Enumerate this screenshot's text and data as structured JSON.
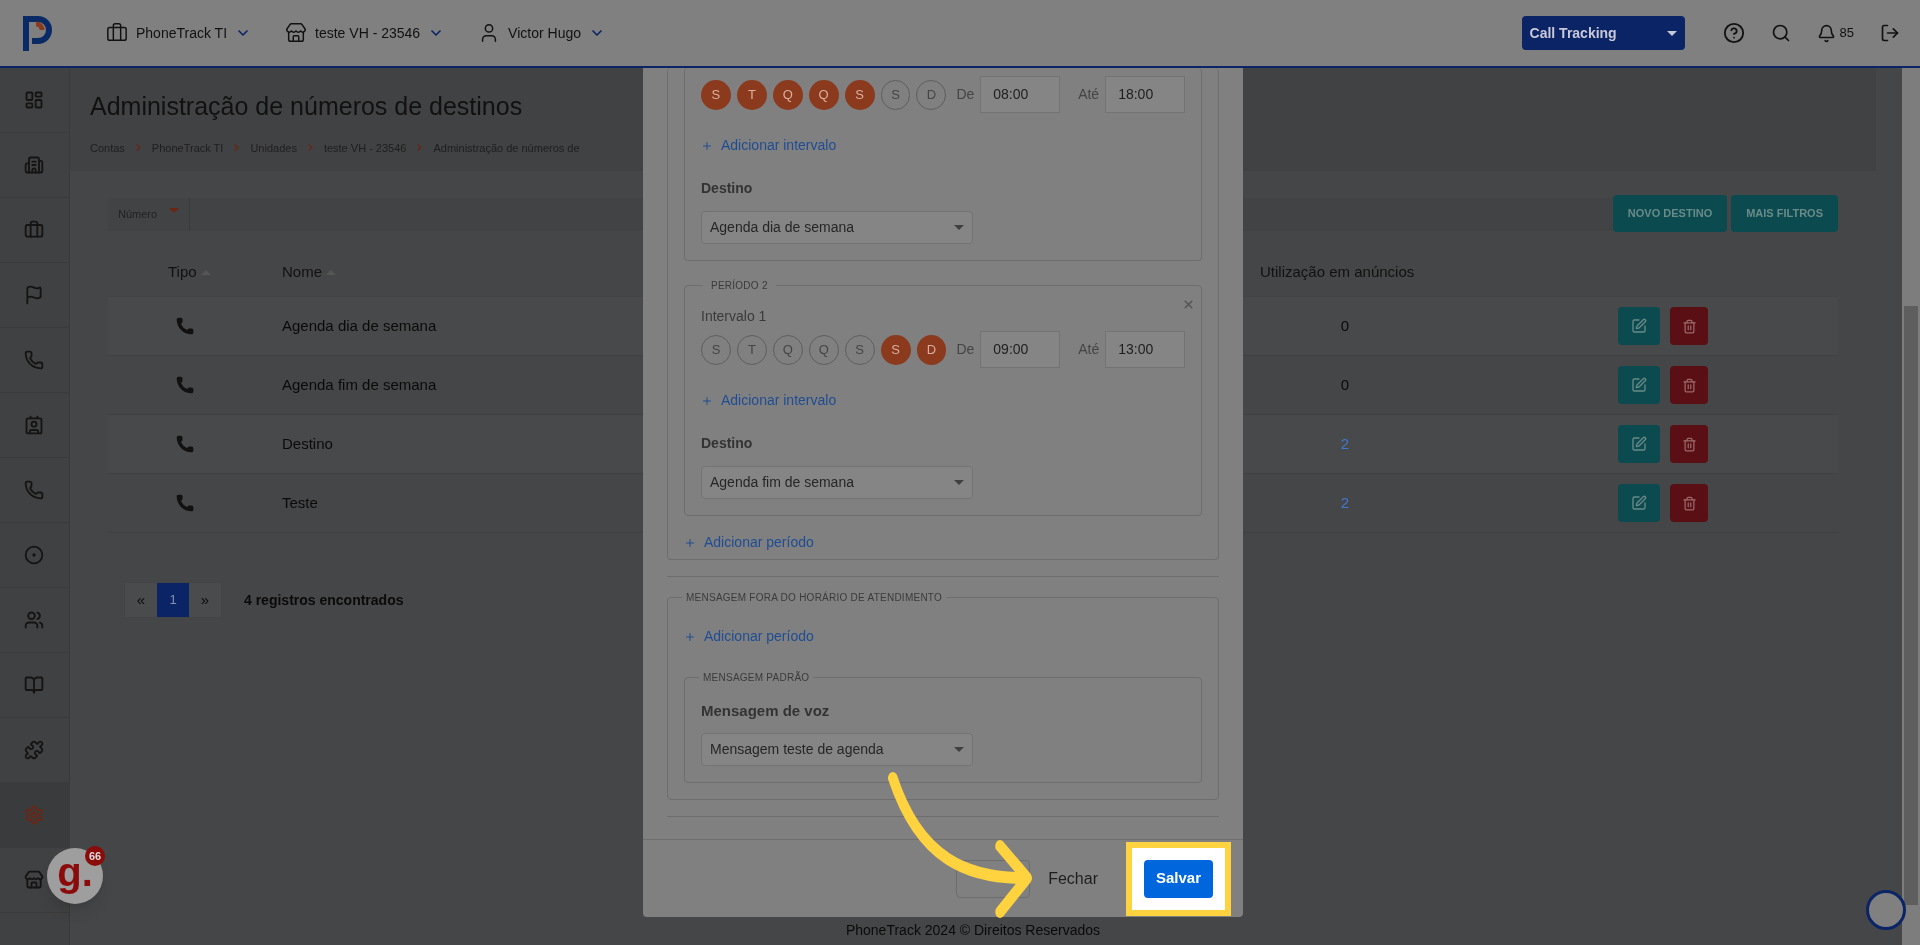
{
  "header": {
    "nav": [
      {
        "label": "PhoneTrack TI"
      },
      {
        "label": "teste VH - 23546"
      },
      {
        "label": "Victor Hugo"
      }
    ],
    "product_select": "Call Tracking",
    "notifications": "85"
  },
  "sidebar": {
    "items": [
      {
        "selected": false
      },
      {
        "selected": false
      },
      {
        "selected": false
      },
      {
        "selected": false
      },
      {
        "selected": false
      },
      {
        "selected": false
      },
      {
        "selected": false
      },
      {
        "selected": false
      },
      {
        "selected": false
      },
      {
        "selected": false
      },
      {
        "selected": false
      },
      {
        "selected": true
      },
      {
        "selected": false
      }
    ]
  },
  "page": {
    "title": "Administração de números de destinos",
    "breadcrumb": [
      "Contas",
      "PhoneTrack TI",
      "Unidades",
      "teste VH - 23546",
      "Administração de números de"
    ],
    "filter": {
      "label": "Número"
    },
    "actions": [
      "NOVO DESTINO",
      "MAIS FILTROS"
    ],
    "table": {
      "columns": [
        {
          "label": "Tipo",
          "sortable": true
        },
        {
          "label": "Nome",
          "sortable": true
        },
        {
          "label": "Utilização em anúncios",
          "sortable": false
        }
      ],
      "rows": [
        {
          "name": "Agenda dia de semana",
          "usage": "0",
          "linked": false
        },
        {
          "name": "Agenda fim de semana",
          "usage": "0",
          "linked": false
        },
        {
          "name": "Destino",
          "usage": "2",
          "linked": true
        },
        {
          "name": "Teste",
          "usage": "2",
          "linked": true
        }
      ]
    },
    "pagination": {
      "prev": "«",
      "pages": [
        {
          "label": "1",
          "selected": true
        }
      ],
      "next": "»",
      "summary": "4 registros encontrados"
    }
  },
  "modal": {
    "periods": [
      {
        "removable": false,
        "intervals": [
          {
            "days": [
              {
                "letter": "S",
                "selected": true
              },
              {
                "letter": "T",
                "selected": true
              },
              {
                "letter": "Q",
                "selected": true
              },
              {
                "letter": "Q",
                "selected": true
              },
              {
                "letter": "S",
                "selected": true
              },
              {
                "letter": "S",
                "selected": false
              },
              {
                "letter": "D",
                "selected": false
              }
            ],
            "from_label": "De",
            "from": "08:00",
            "to_label": "Até",
            "to": "18:00"
          }
        ],
        "add_interval": "Adicionar intervalo",
        "destination_label": "Destino",
        "destination": "Agenda dia de semana"
      },
      {
        "legend": "PERÍODO 2",
        "removable": true,
        "intervals": [
          {
            "label": "Intervalo 1",
            "days": [
              {
                "letter": "S",
                "selected": false
              },
              {
                "letter": "T",
                "selected": false
              },
              {
                "letter": "Q",
                "selected": false
              },
              {
                "letter": "Q",
                "selected": false
              },
              {
                "letter": "S",
                "selected": false
              },
              {
                "letter": "S",
                "selected": true
              },
              {
                "letter": "D",
                "selected": true
              }
            ],
            "from_label": "De",
            "from": "09:00",
            "to_label": "Até",
            "to": "13:00"
          }
        ],
        "add_interval": "Adicionar intervalo",
        "destination_label": "Destino",
        "destination": "Agenda fim de semana"
      }
    ],
    "add_period": "Adicionar período",
    "off_hours": {
      "legend": "MENSAGEM FORA DO HORÁRIO DE ATENDIMENTO",
      "add_period": "Adicionar período",
      "default": {
        "legend": "MENSAGEM PADRÃO",
        "label": "Mensagem de voz",
        "value": "Mensagem teste de agenda"
      }
    },
    "buttons": [
      {
        "kind": "blank"
      },
      {
        "kind": "secondary",
        "label": "Fechar"
      },
      {
        "kind": "primary",
        "label": "Salvar",
        "highlighted": true
      }
    ]
  },
  "footer": "PhoneTrack 2024 © Direitos Reservados",
  "widget": {
    "logo": "g.",
    "badge": "66"
  }
}
